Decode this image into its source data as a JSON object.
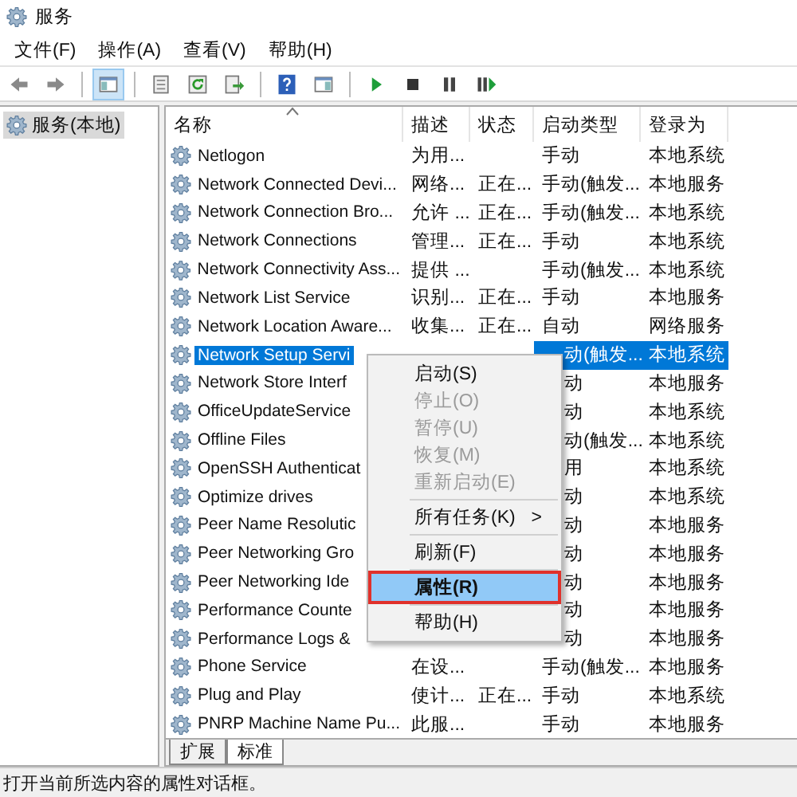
{
  "window": {
    "title": "服务"
  },
  "menu_bar": [
    "文件(F)",
    "操作(A)",
    "查看(V)",
    "帮助(H)"
  ],
  "toolbar": [
    {
      "pressed": false
    },
    {
      "pressed": false
    },
    {
      "pressed": true
    },
    {
      "pressed": false
    },
    {
      "pressed": false
    },
    {
      "pressed": false
    },
    {
      "pressed": false
    },
    {
      "pressed": false
    },
    {
      "pressed": false
    },
    {
      "pressed": false
    },
    {
      "pressed": false
    },
    {
      "pressed": false
    }
  ],
  "tree": {
    "items": [
      {
        "label": "服务(本地)",
        "selected": true
      }
    ]
  },
  "table": {
    "columns": [
      "名称",
      "描述",
      "状态",
      "启动类型",
      "登录为"
    ],
    "rows": [
      {
        "name": "Netlogon",
        "description": "为用...",
        "status": "",
        "startup": "手动",
        "logon": "本地系统",
        "selected": false,
        "covered": false
      },
      {
        "name": "Network Connected Devi...",
        "description": "网络...",
        "status": "正在...",
        "startup": "手动(触发...",
        "logon": "本地服务",
        "selected": false,
        "covered": false
      },
      {
        "name": "Network Connection Bro...",
        "description": "允许 ...",
        "status": "正在...",
        "startup": "手动(触发...",
        "logon": "本地系统",
        "selected": false,
        "covered": false
      },
      {
        "name": "Network Connections",
        "description": "管理...",
        "status": "正在...",
        "startup": "手动",
        "logon": "本地系统",
        "selected": false,
        "covered": false
      },
      {
        "name": "Network Connectivity Ass...",
        "description": "提供 ...",
        "status": "",
        "startup": "手动(触发...",
        "logon": "本地系统",
        "selected": false,
        "covered": false
      },
      {
        "name": "Network List Service",
        "description": "识别...",
        "status": "正在...",
        "startup": "手动",
        "logon": "本地服务",
        "selected": false,
        "covered": false
      },
      {
        "name": "Network Location Aware...",
        "description": "收集...",
        "status": "正在...",
        "startup": "自动",
        "logon": "网络服务",
        "selected": false,
        "covered": false
      },
      {
        "name": "Network Setup Servi",
        "description": "",
        "status": "",
        "startup": "动(触发...",
        "logon": "本地系统",
        "selected": true,
        "covered": true
      },
      {
        "name": "Network Store Interf",
        "description": "",
        "status": "",
        "startup": "动",
        "logon": "本地服务",
        "selected": false,
        "covered": true
      },
      {
        "name": "OfficeUpdateService",
        "description": "",
        "status": "",
        "startup": "动",
        "logon": "本地系统",
        "selected": false,
        "covered": true
      },
      {
        "name": "Offline Files",
        "description": "",
        "status": "",
        "startup": "动(触发...",
        "logon": "本地系统",
        "selected": false,
        "covered": true
      },
      {
        "name": "OpenSSH Authenticat",
        "description": "",
        "status": "",
        "startup": "用",
        "logon": "本地系统",
        "selected": false,
        "covered": true
      },
      {
        "name": "Optimize drives",
        "description": "",
        "status": "",
        "startup": "动",
        "logon": "本地系统",
        "selected": false,
        "covered": true
      },
      {
        "name": "Peer Name Resolutic",
        "description": "",
        "status": "",
        "startup": "动",
        "logon": "本地服务",
        "selected": false,
        "covered": true
      },
      {
        "name": "Peer Networking Gro",
        "description": "",
        "status": "",
        "startup": "动",
        "logon": "本地服务",
        "selected": false,
        "covered": true
      },
      {
        "name": "Peer Networking Ide",
        "description": "",
        "status": "",
        "startup": "动",
        "logon": "本地服务",
        "selected": false,
        "covered": true
      },
      {
        "name": "Performance Counte",
        "description": "",
        "status": "",
        "startup": "动",
        "logon": "本地服务",
        "selected": false,
        "covered": true
      },
      {
        "name": "Performance Logs &",
        "description": "",
        "status": "",
        "startup": "动",
        "logon": "本地服务",
        "selected": false,
        "covered": true
      },
      {
        "name": "Phone Service",
        "description": "在设...",
        "status": "",
        "startup": "手动(触发...",
        "logon": "本地服务",
        "selected": false,
        "covered": false
      },
      {
        "name": "Plug and Play",
        "description": "使计...",
        "status": "正在...",
        "startup": "手动",
        "logon": "本地系统",
        "selected": false,
        "covered": false
      },
      {
        "name": "PNRP Machine Name Pu...",
        "description": "此服...",
        "status": "",
        "startup": "手动",
        "logon": "本地服务",
        "selected": false,
        "covered": false
      }
    ]
  },
  "tabs": [
    {
      "label": "扩展",
      "selected": false
    },
    {
      "label": "标准",
      "selected": true
    }
  ],
  "context_menu": {
    "items": [
      {
        "kind": "item",
        "label": "启动(S)",
        "disabled": false,
        "selected": false,
        "default": false
      },
      {
        "kind": "item",
        "label": "停止(O)",
        "disabled": true,
        "selected": false,
        "default": false
      },
      {
        "kind": "item",
        "label": "暂停(U)",
        "disabled": true,
        "selected": false,
        "default": false
      },
      {
        "kind": "item",
        "label": "恢复(M)",
        "disabled": true,
        "selected": false,
        "default": false
      },
      {
        "kind": "item",
        "label": "重新启动(E)",
        "disabled": true,
        "selected": false,
        "default": false
      },
      {
        "kind": "separator"
      },
      {
        "kind": "item",
        "label": "所有任务(K)",
        "arrow": ">",
        "disabled": false,
        "selected": false,
        "default": false
      },
      {
        "kind": "separator"
      },
      {
        "kind": "item",
        "label": "刷新(F)",
        "disabled": false,
        "selected": false,
        "default": false
      },
      {
        "kind": "separator"
      },
      {
        "kind": "item",
        "label": "属性(R)",
        "disabled": false,
        "selected": true,
        "default": true
      },
      {
        "kind": "separator"
      },
      {
        "kind": "item",
        "label": "帮助(H)",
        "disabled": false,
        "selected": false,
        "default": false
      }
    ]
  },
  "status_bar": "打开当前所选内容的属性对话框。"
}
